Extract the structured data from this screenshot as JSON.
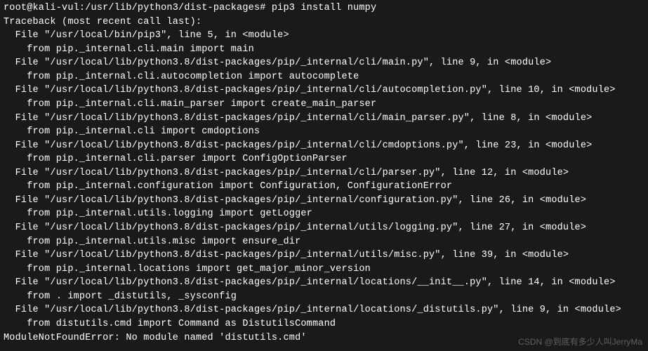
{
  "terminal": {
    "lines": [
      "root@kali-vul:/usr/lib/python3/dist-packages# pip3 install numpy",
      "Traceback (most recent call last):",
      "  File \"/usr/local/bin/pip3\", line 5, in <module>",
      "    from pip._internal.cli.main import main",
      "  File \"/usr/local/lib/python3.8/dist-packages/pip/_internal/cli/main.py\", line 9, in <module>",
      "    from pip._internal.cli.autocompletion import autocomplete",
      "  File \"/usr/local/lib/python3.8/dist-packages/pip/_internal/cli/autocompletion.py\", line 10, in <module>",
      "    from pip._internal.cli.main_parser import create_main_parser",
      "  File \"/usr/local/lib/python3.8/dist-packages/pip/_internal/cli/main_parser.py\", line 8, in <module>",
      "    from pip._internal.cli import cmdoptions",
      "  File \"/usr/local/lib/python3.8/dist-packages/pip/_internal/cli/cmdoptions.py\", line 23, in <module>",
      "    from pip._internal.cli.parser import ConfigOptionParser",
      "  File \"/usr/local/lib/python3.8/dist-packages/pip/_internal/cli/parser.py\", line 12, in <module>",
      "    from pip._internal.configuration import Configuration, ConfigurationError",
      "  File \"/usr/local/lib/python3.8/dist-packages/pip/_internal/configuration.py\", line 26, in <module>",
      "    from pip._internal.utils.logging import getLogger",
      "  File \"/usr/local/lib/python3.8/dist-packages/pip/_internal/utils/logging.py\", line 27, in <module>",
      "    from pip._internal.utils.misc import ensure_dir",
      "  File \"/usr/local/lib/python3.8/dist-packages/pip/_internal/utils/misc.py\", line 39, in <module>",
      "    from pip._internal.locations import get_major_minor_version",
      "  File \"/usr/local/lib/python3.8/dist-packages/pip/_internal/locations/__init__.py\", line 14, in <module>",
      "    from . import _distutils, _sysconfig",
      "  File \"/usr/local/lib/python3.8/dist-packages/pip/_internal/locations/_distutils.py\", line 9, in <module>",
      "    from distutils.cmd import Command as DistutilsCommand",
      "ModuleNotFoundError: No module named 'distutils.cmd'"
    ]
  },
  "watermark": {
    "text": "CSDN @到底有多少人叫JerryMa"
  }
}
